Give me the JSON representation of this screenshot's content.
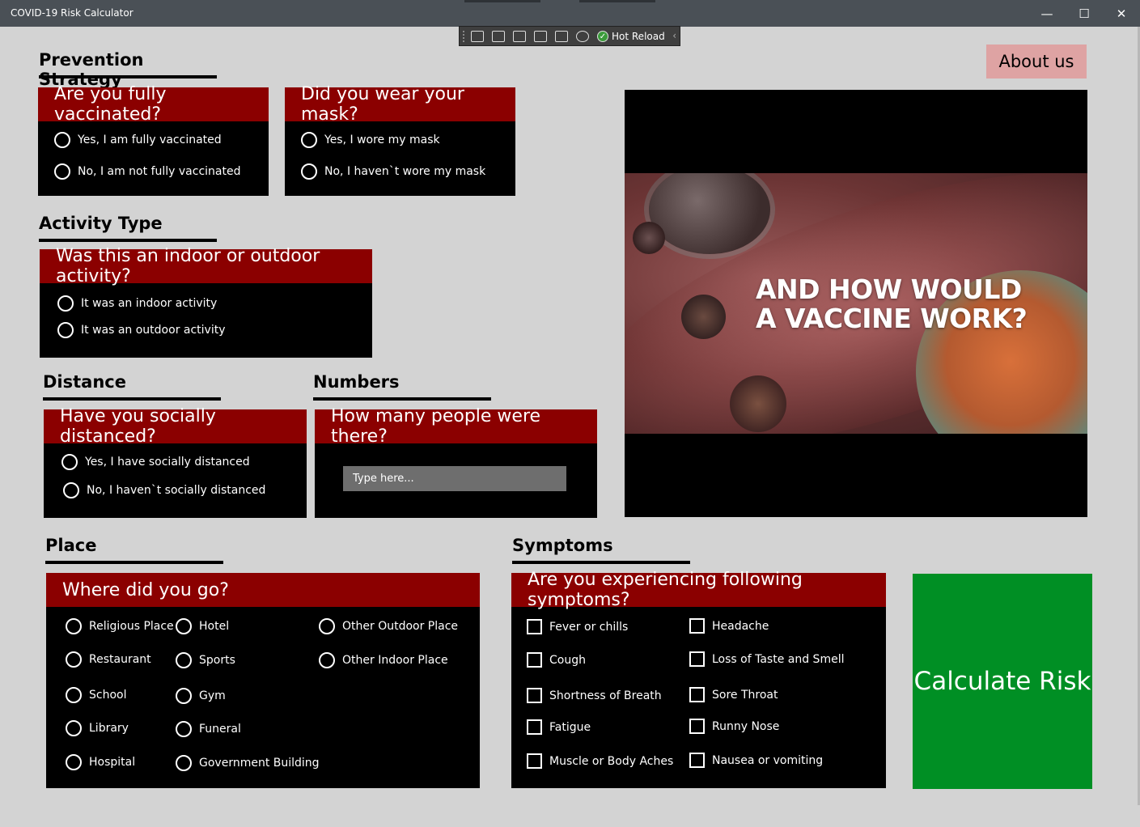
{
  "window": {
    "title": "COVID-19 Risk Calculator",
    "minimize_glyph": "—",
    "maximize_glyph": "☐",
    "close_glyph": "✕"
  },
  "debug_toolbar": {
    "icons": [
      "live-visual-tree-icon",
      "select-element-icon",
      "display-layout-adorners-icon",
      "track-focus-icon",
      "preview-selection-icon",
      "binding-failures-icon"
    ],
    "hot_reload_label": "Hot Reload",
    "collapse_glyph": "‹"
  },
  "about_button": "About us",
  "sections": {
    "prevention": "Prevention Strategy",
    "activity": "Activity Type",
    "distance": "Distance",
    "numbers": "Numbers",
    "place": "Place",
    "symptoms": "Symptoms"
  },
  "vaccinated": {
    "question": "Are you fully vaccinated?",
    "options": [
      "Yes, I am fully vaccinated",
      "No, I am not fully vaccinated"
    ]
  },
  "mask": {
    "question": "Did you wear your mask?",
    "options": [
      "Yes, I wore my mask",
      "No, I haven`t wore my mask"
    ]
  },
  "activity": {
    "question": "Was this an indoor or outdoor activity?",
    "options": [
      "It was an indoor activity",
      "It was an outdoor activity"
    ]
  },
  "distance": {
    "question": "Have you socially distanced?",
    "options": [
      "Yes, I have socially distanced",
      "No, I haven`t socially distanced"
    ]
  },
  "numbers": {
    "question": "How many people were there?",
    "placeholder": "Type here..."
  },
  "place": {
    "question": "Where did you go?",
    "col1": [
      "Religious Place",
      "Restaurant",
      "School",
      "Library",
      "Hospital"
    ],
    "col2": [
      "Hotel",
      "Sports",
      "Gym",
      "Funeral",
      "Government Building"
    ],
    "col3": [
      "Other Outdoor Place",
      "Other Indoor Place"
    ]
  },
  "symptoms": {
    "question": "Are you experiencing following symptoms?",
    "col1": [
      "Fever or chills",
      "Cough",
      "Shortness of Breath",
      "Fatigue",
      "Muscle or Body Aches"
    ],
    "col2": [
      "Headache",
      "Loss of Taste and Smell",
      "Sore Throat",
      "Runny Nose",
      "Nausea or vomiting"
    ]
  },
  "video": {
    "caption_line1": "AND HOW WOULD",
    "caption_line2": "A VACCINE WORK?"
  },
  "calculate_button": "Calculate Risk",
  "colors": {
    "card_header": "#8b0000",
    "card_body": "#000000",
    "calculate": "#008f24",
    "about": "#dea3a3",
    "background": "#d3d3d3"
  }
}
